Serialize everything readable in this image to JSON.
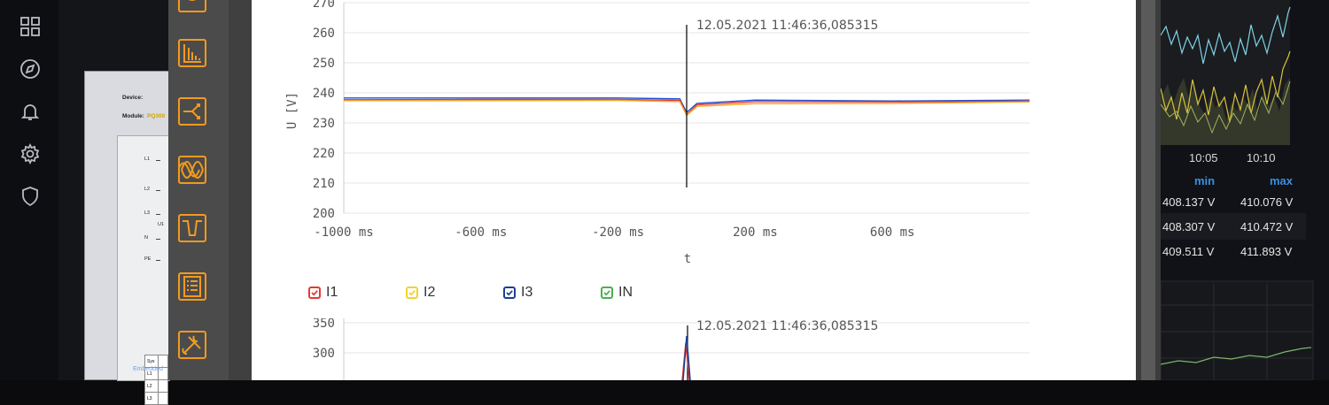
{
  "nav": {
    "items": [
      {
        "icon": "dashboard-grid-icon"
      },
      {
        "icon": "compass-icon"
      },
      {
        "icon": "bell-icon"
      },
      {
        "icon": "gear-icon"
      },
      {
        "icon": "shield-icon"
      }
    ]
  },
  "device": {
    "device_label": "Device:",
    "module_label": "Module:",
    "module_value": "PQ300",
    "lines": [
      "L1",
      "L2",
      "L3",
      "N",
      "PE"
    ],
    "u_label": "U1",
    "table": [
      [
        "Sys",
        ""
      ],
      [
        "L1",
        ""
      ],
      [
        "L2",
        ""
      ],
      [
        "L3",
        ""
      ]
    ],
    "embedded_label": "Embedded"
  },
  "toolbar": {
    "tools": [
      "overview-icon",
      "bar-chart-icon",
      "phasor-icon",
      "waveform-icon",
      "voltage-dip-icon",
      "event-list-icon",
      "settings-tools-icon"
    ]
  },
  "chart_voltage": {
    "type": "line",
    "timestamp_label": "12.05.2021 11:46:36,085315",
    "ylabel": "U [V]",
    "xlabel": "t",
    "yticks": [
      "270",
      "260",
      "250",
      "240",
      "230",
      "220",
      "210",
      "200"
    ],
    "xticks": [
      "-1000 ms",
      "-600 ms",
      "-200 ms",
      "200 ms",
      "600 ms"
    ]
  },
  "legend": [
    {
      "label": "I1",
      "color": "#e53935"
    },
    {
      "label": "I2",
      "color": "#f2d22e"
    },
    {
      "label": "I3",
      "color": "#1e3f8f"
    },
    {
      "label": "IN",
      "color": "#4caf50"
    }
  ],
  "chart_current": {
    "timestamp_label": "12.05.2021 11:46:36,085315",
    "yticks": [
      "350",
      "300"
    ]
  },
  "chart_data": [
    {
      "type": "line",
      "title": "",
      "xlabel": "t",
      "ylabel": "U [V]",
      "ylim": [
        200,
        270
      ],
      "xlim": [
        -1000,
        1000
      ],
      "x_unit": "ms",
      "grid": true,
      "series": [
        {
          "color": "#1e4fd8",
          "x": [
            -1000,
            -600,
            -200,
            -20,
            0,
            30,
            200,
            600,
            1000
          ],
          "y": [
            238.3,
            238.3,
            238.3,
            238.0,
            233.5,
            236.5,
            237.6,
            237.3,
            237.6
          ]
        },
        {
          "color": "#e53935",
          "x": [
            -1000,
            -600,
            -200,
            -20,
            0,
            30,
            200,
            600,
            1000
          ],
          "y": [
            237.7,
            237.8,
            237.8,
            237.5,
            232.7,
            236.0,
            237.1,
            237.0,
            237.2
          ]
        },
        {
          "color": "#f5a623",
          "x": [
            -1000,
            -600,
            -200,
            -20,
            0,
            30,
            200,
            600,
            1000
          ],
          "y": [
            237.4,
            237.4,
            237.5,
            237.1,
            232.5,
            235.5,
            236.4,
            236.5,
            237.0
          ]
        }
      ]
    }
  ],
  "right_panel": {
    "time_labels": [
      "10:05",
      "10:10"
    ],
    "col_min": "min",
    "col_max": "max",
    "rows": [
      {
        "min": "408.137 V",
        "max": "410.076 V"
      },
      {
        "min": "408.307 V",
        "max": "410.472 V"
      },
      {
        "min": "409.511 V",
        "max": "411.893 V"
      }
    ]
  }
}
